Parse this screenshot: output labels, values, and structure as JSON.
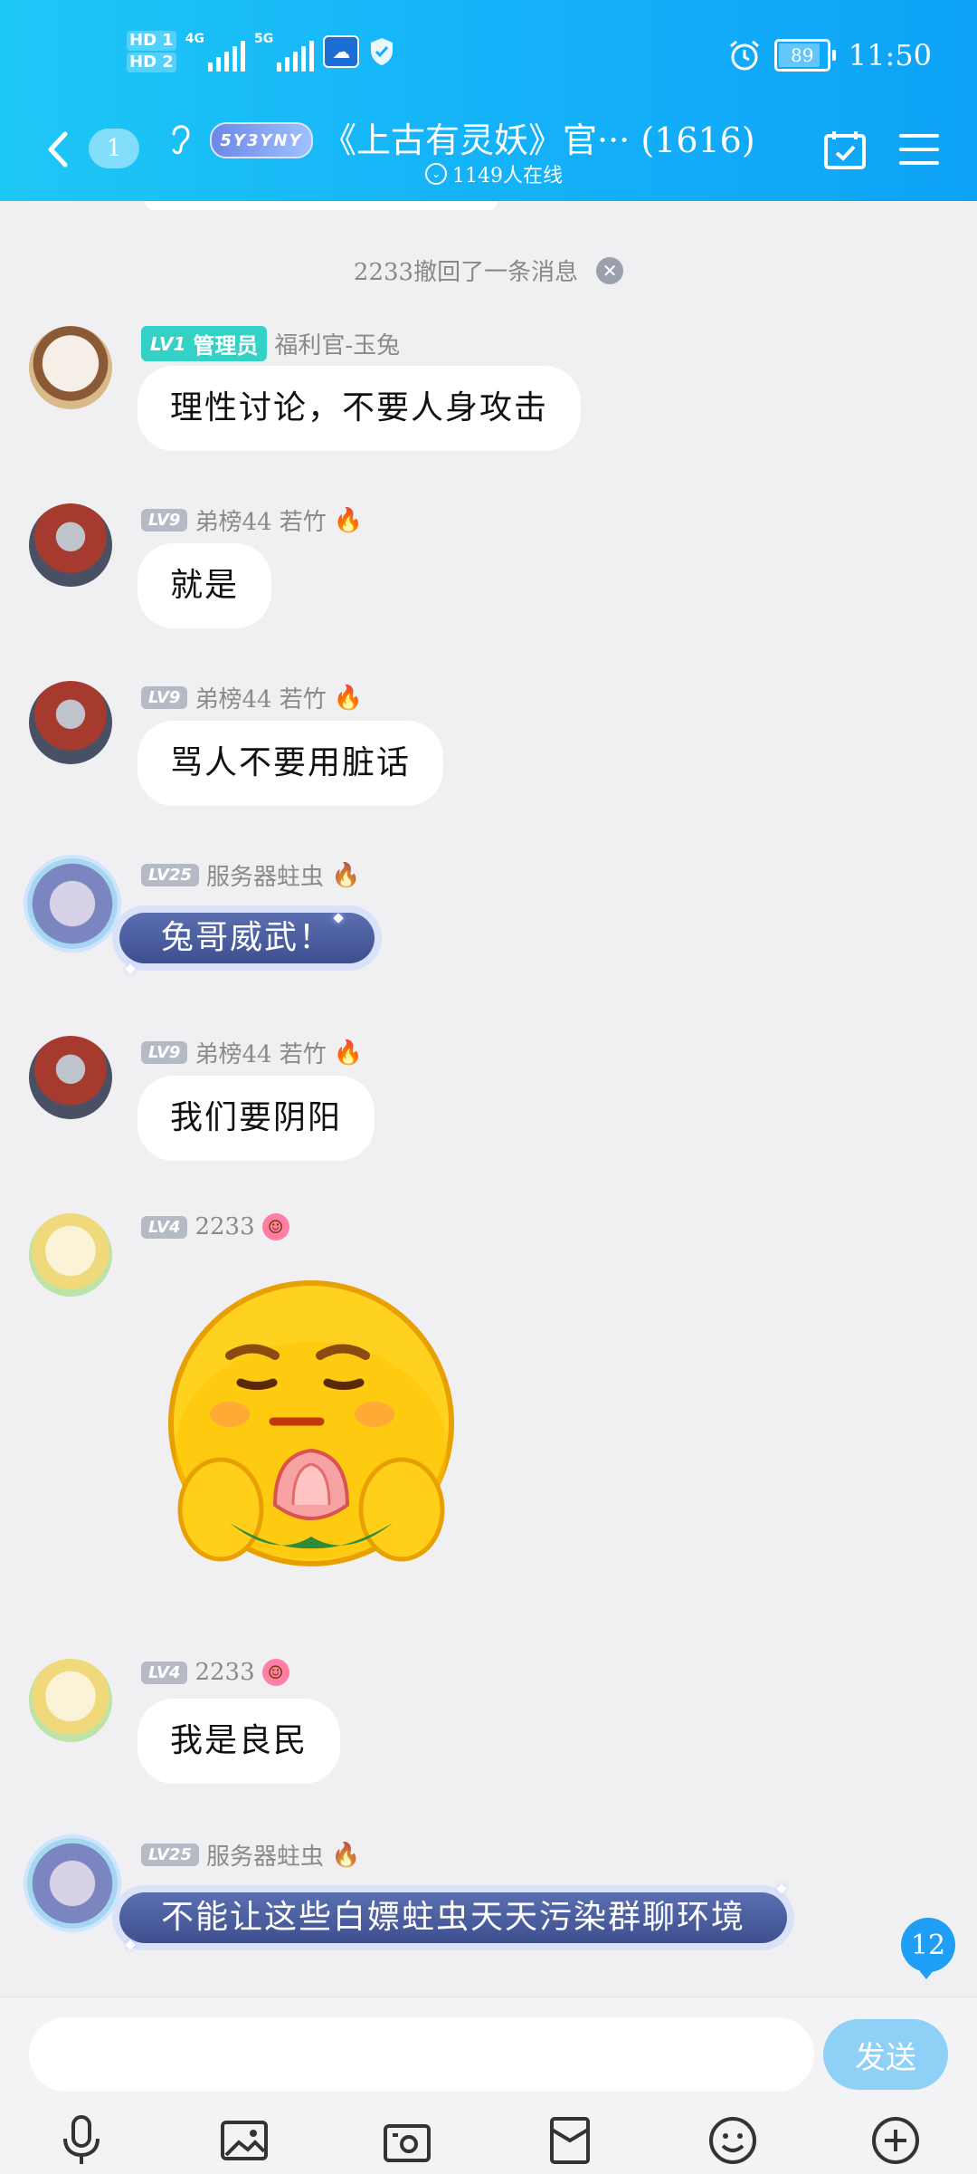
{
  "status_bar": {
    "hd1": "HD 1",
    "hd2": "HD 2",
    "net1": "4G",
    "net2": "5G",
    "battery": "89",
    "time": "11:50"
  },
  "header": {
    "unread_count": "1",
    "group_logo_text": "5Y3YNY",
    "title": "《上古有灵妖》官··· (1616)",
    "online": "1149人在线"
  },
  "recall_notice": "2233撤回了一条消息",
  "messages": [
    {
      "admin_level": "LV1",
      "admin_label": "管理员",
      "name": "福利官-玉兔",
      "text": "理性讨论，不要人身攻击"
    },
    {
      "level": "LV9",
      "name": "弟榜44  若竹",
      "text": "就是"
    },
    {
      "level": "LV9",
      "name": "弟榜44  若竹",
      "text": "骂人不要用脏话"
    },
    {
      "level": "LV25",
      "name": "服务器蛀虫",
      "text": "兔哥威武！"
    },
    {
      "level": "LV9",
      "name": "弟榜44  若竹",
      "text": "我们要阴阳"
    },
    {
      "level": "LV4",
      "name": "2233",
      "sticker": "praying-emoji"
    },
    {
      "level": "LV4",
      "name": "2233",
      "text": "我是良民"
    },
    {
      "level": "LV25",
      "name": "服务器蛀虫",
      "text": "不能让这些白嫖蛀虫天天污染群聊环境"
    }
  ],
  "unread_badge": "12",
  "input": {
    "placeholder": "",
    "send_label": "发送"
  },
  "colors": {
    "header_start": "#1ec8f6",
    "header_end": "#0ea3f7",
    "admin_badge": "#34d1c7",
    "special_bubble": "#3e4f8f"
  }
}
